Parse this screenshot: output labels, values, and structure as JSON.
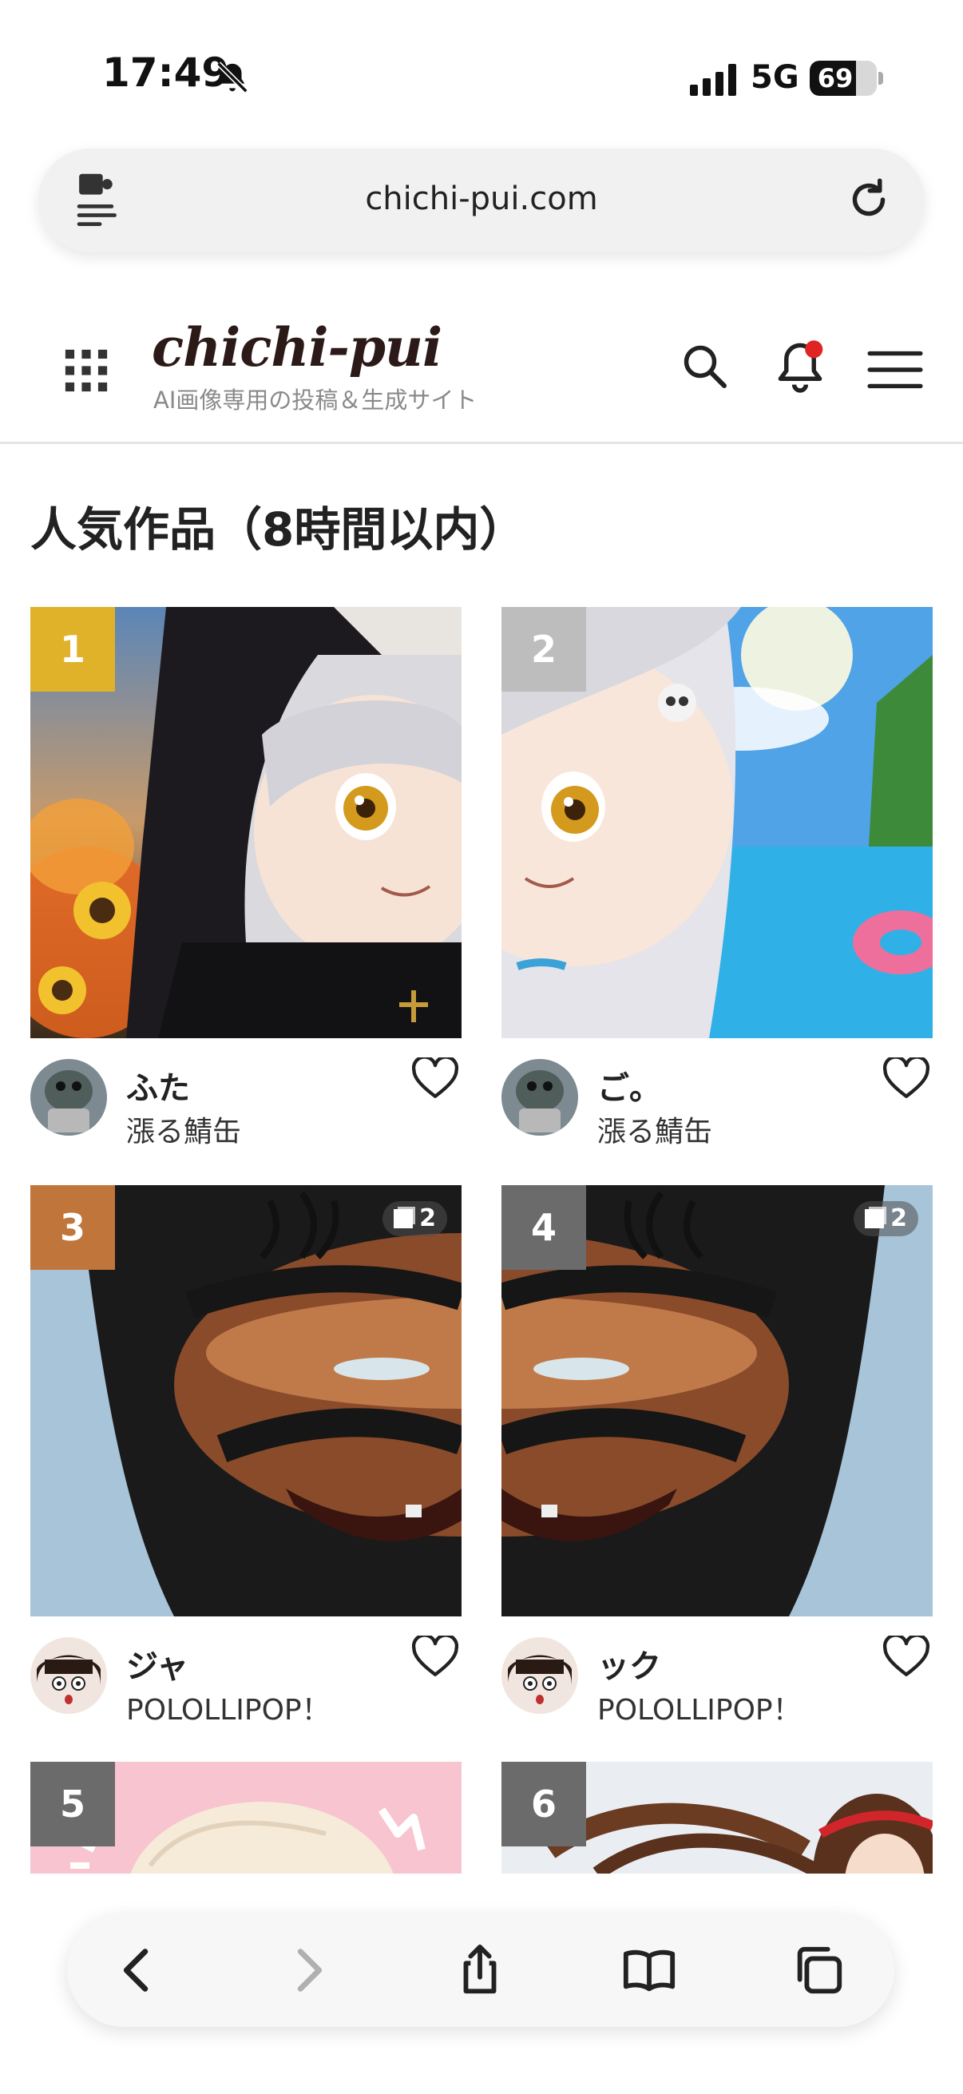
{
  "status": {
    "time": "17:49",
    "network": "5G",
    "battery": "69",
    "battery_level": 0.69
  },
  "browser": {
    "url": "chichi-pui.com"
  },
  "site": {
    "logo": "chichi-pui",
    "tagline": "AI画像専用の投稿＆生成サイト",
    "notification_dot_color": "#e02424"
  },
  "section": {
    "title": "人気作品（8時間以内）"
  },
  "cards": [
    {
      "rank": "1",
      "title": "ふた",
      "author": "漲る鯖缶",
      "rank_color": "#e0b22a"
    },
    {
      "rank": "2",
      "title": "ご。",
      "author": "漲る鯖缶",
      "rank_color": "#bdbdbd"
    },
    {
      "rank": "3",
      "title": "ジャ",
      "author": "POLOLLIPOP！",
      "count": "2",
      "rank_color": "#c0753a"
    },
    {
      "rank": "4",
      "title": "ック",
      "author": "POLOLLIPOP！",
      "count": "2",
      "rank_color": "#6b6b6b"
    },
    {
      "rank": "5",
      "rank_color": "#6b6b6b"
    },
    {
      "rank": "6",
      "rank_color": "#6b6b6b"
    }
  ]
}
